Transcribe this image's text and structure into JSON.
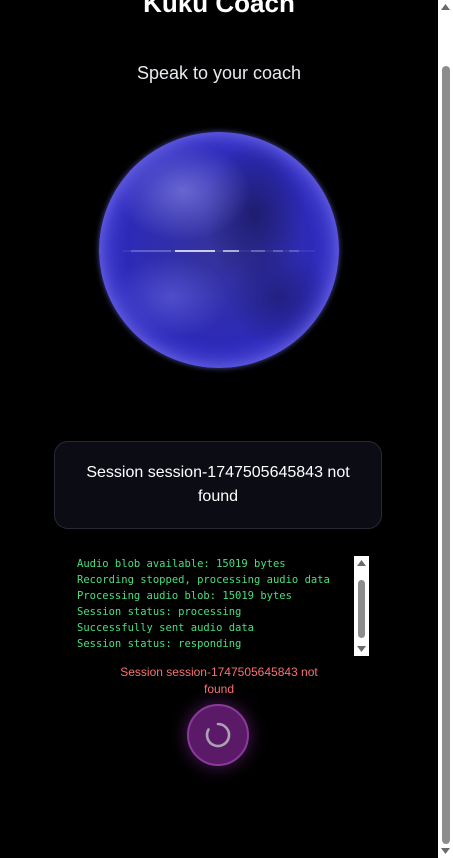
{
  "app": {
    "title": "Kuku Coach",
    "subtitle": "Speak to your coach"
  },
  "orb": {
    "icon": "voice-orb",
    "colors": {
      "core": "#2e2ab8",
      "rim": "#6f6af0",
      "wave": "#ffffff"
    }
  },
  "status_card": {
    "message": "Session session-1747505645843 not found"
  },
  "log": {
    "lines": [
      "Audio blob available: 15019 bytes",
      "Recording stopped, processing audio data",
      "Processing audio blob: 15019 bytes",
      "Session status: processing",
      "Successfully sent audio data",
      "Session status: responding"
    ],
    "text_color": "#4ade80"
  },
  "error": {
    "message": "Session session-1747505645843 not found",
    "color": "#f87171"
  },
  "mic_button": {
    "icon": "loading-spinner-icon",
    "state": "loading",
    "color": "#5a1a68"
  }
}
